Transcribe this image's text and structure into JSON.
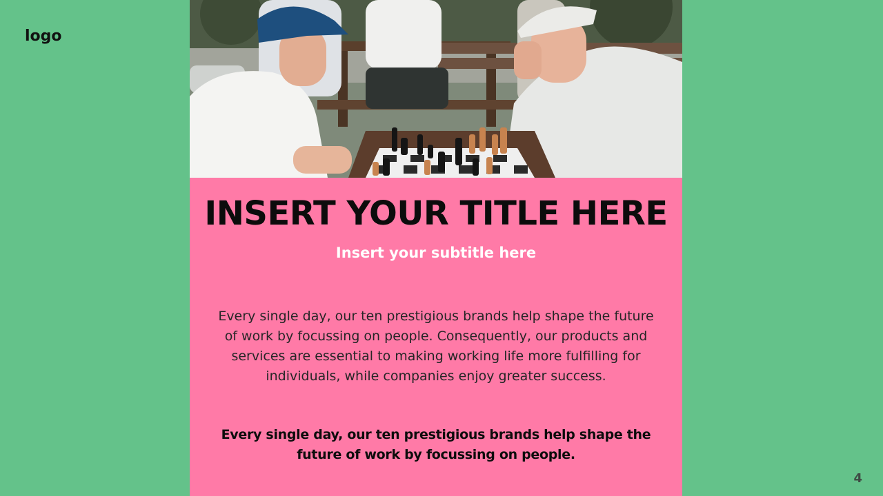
{
  "slide": {
    "logo": "logo",
    "page_number": "4",
    "background_color": "#64c28a",
    "panel_color": "#ff7aa7"
  },
  "content": {
    "title": "INSERT YOUR TITLE HERE",
    "subtitle": "Insert your subtitle here",
    "body": "Every single day, our ten prestigious brands help shape the future of work by focussing on people. Consequently, our products and services are essential to making working life more fulfilling for individuals, while companies enjoy greater success.",
    "emphasis": "Every single day, our ten prestigious brands help shape the future of work by focussing on people."
  },
  "image": {
    "subject": "two elderly men playing chess at an outdoor table",
    "icon": "photo-chess-players"
  }
}
